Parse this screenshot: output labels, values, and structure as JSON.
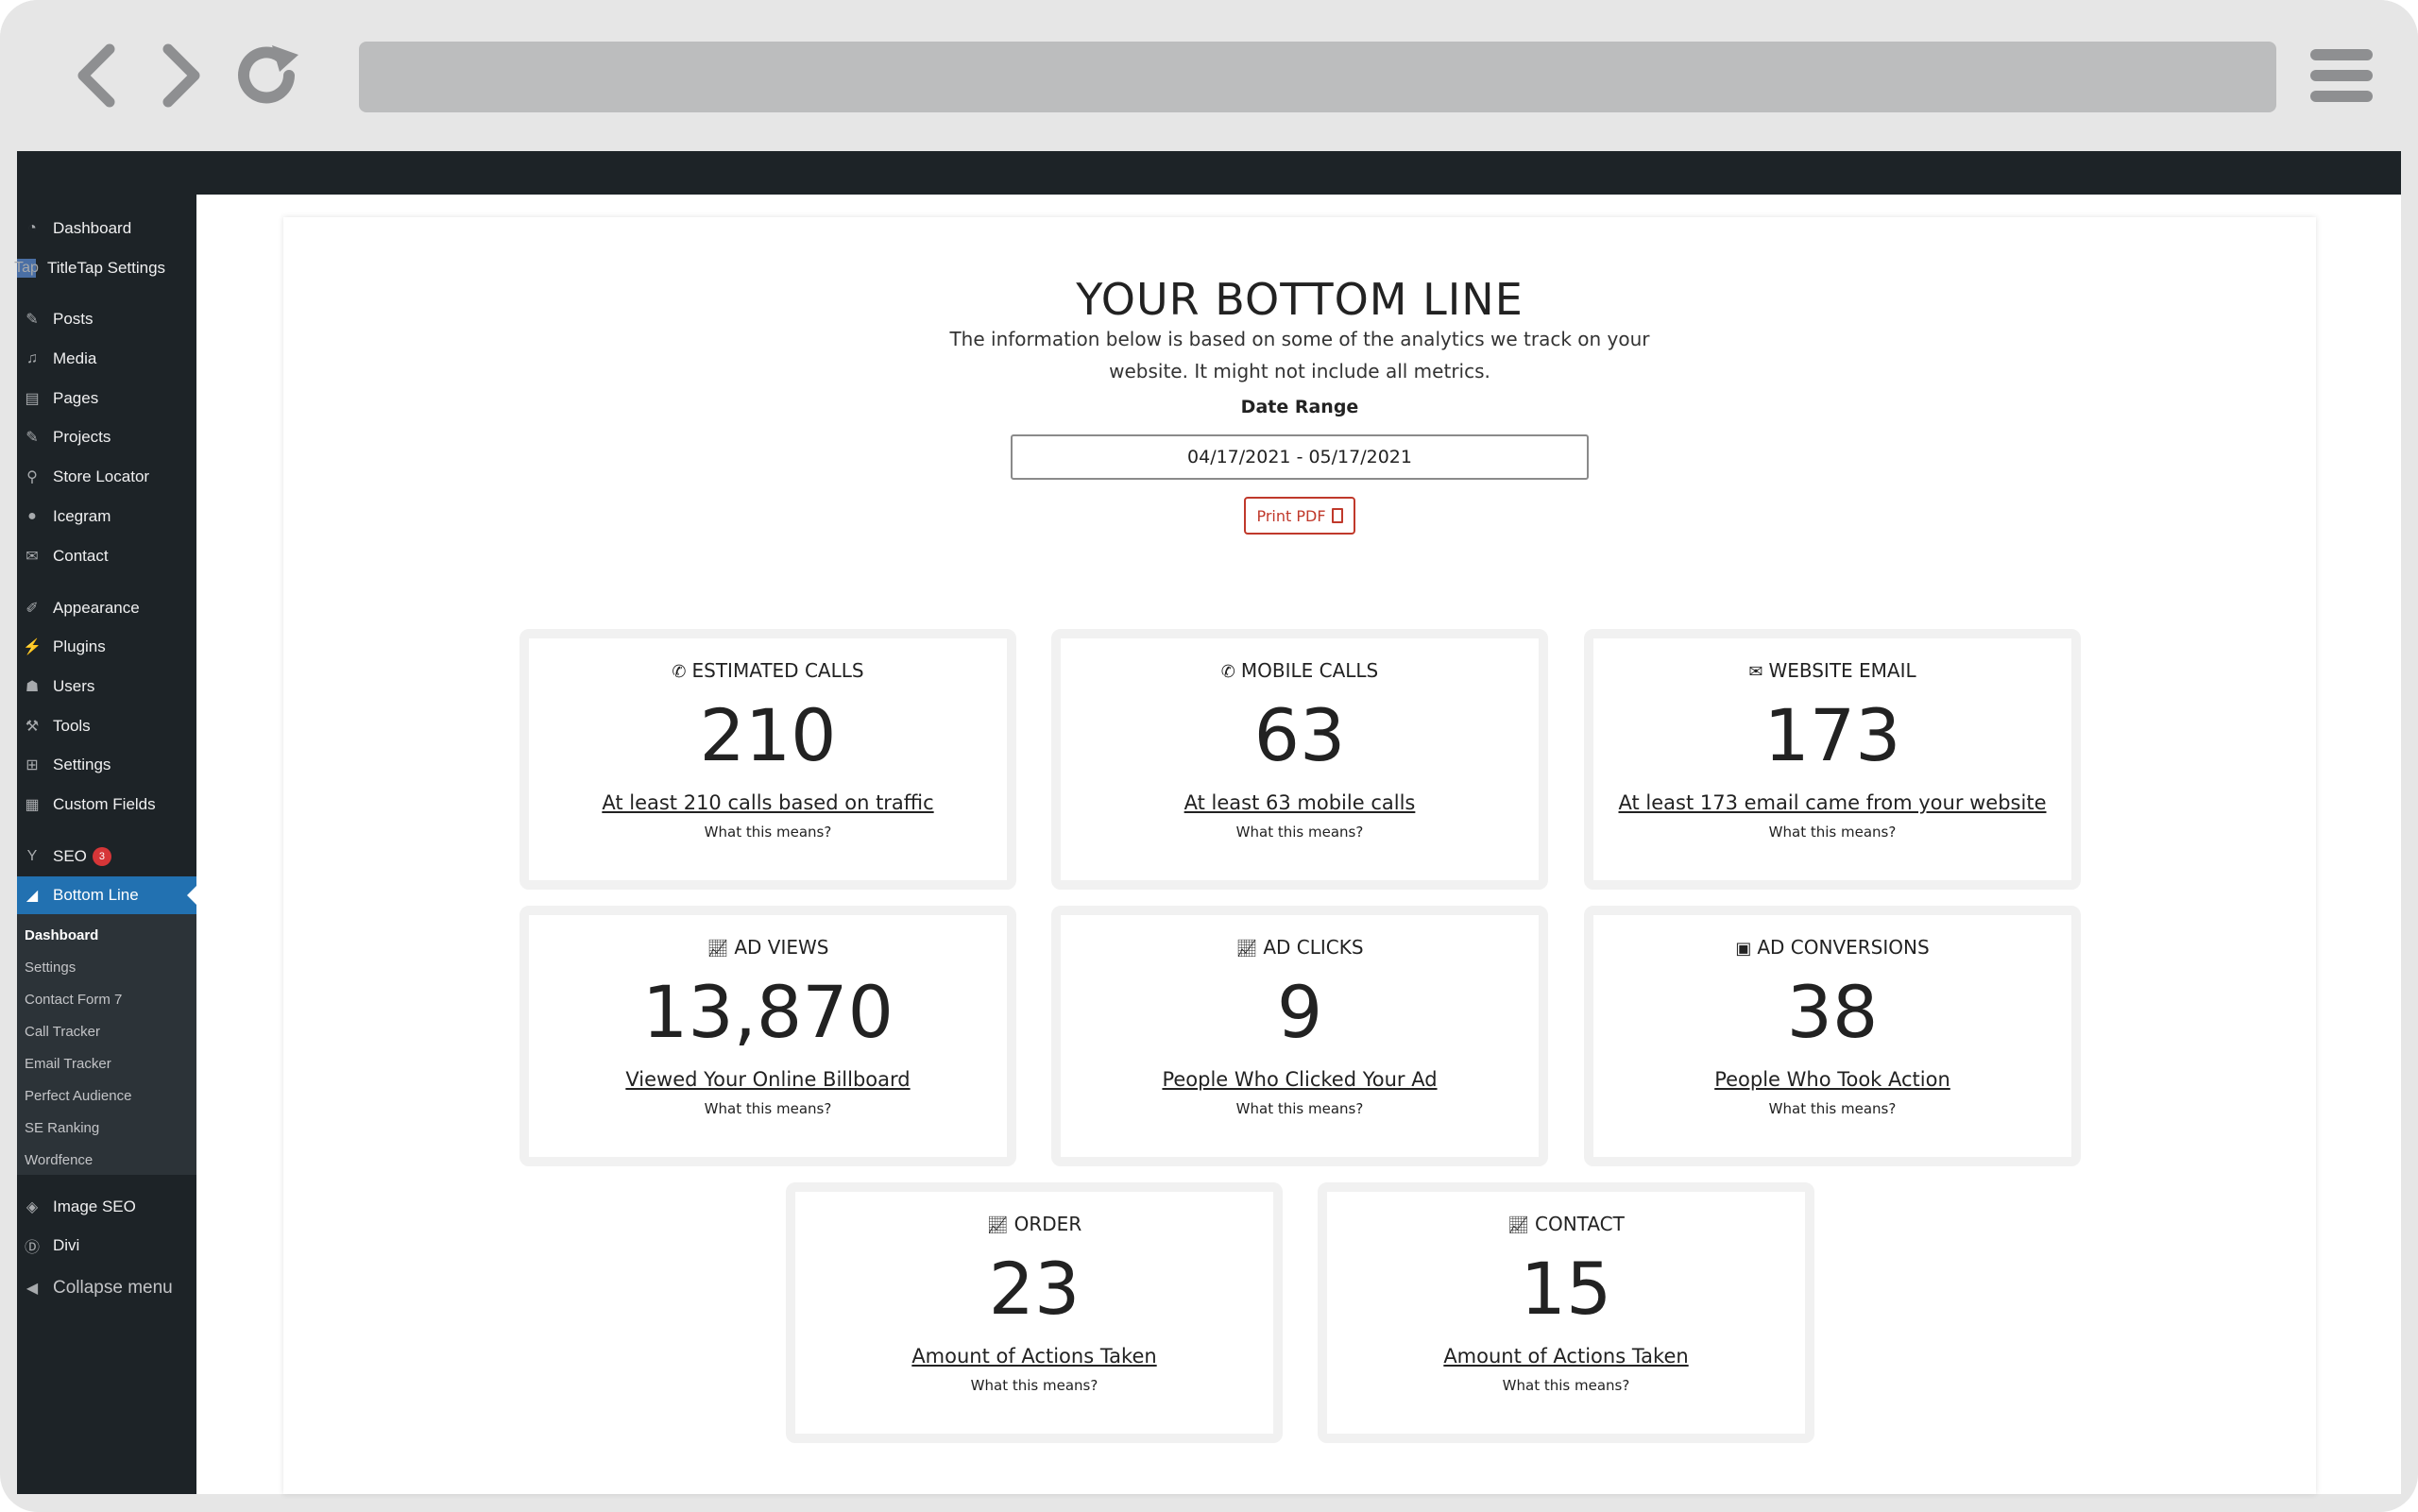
{
  "sidebar": {
    "items": [
      {
        "label": "Dashboard",
        "icon": "dashboard-icon"
      },
      {
        "label": "TitleTap Settings",
        "icon": "titletap-icon"
      },
      {
        "label": "Posts",
        "icon": "pin-icon"
      },
      {
        "label": "Media",
        "icon": "media-icon"
      },
      {
        "label": "Pages",
        "icon": "pages-icon"
      },
      {
        "label": "Projects",
        "icon": "pin-icon"
      },
      {
        "label": "Store Locator",
        "icon": "location-pin-icon"
      },
      {
        "label": "Icegram",
        "icon": "icegram-icon"
      },
      {
        "label": "Contact",
        "icon": "mail-icon"
      },
      {
        "label": "Appearance",
        "icon": "paintbrush-icon"
      },
      {
        "label": "Plugins",
        "icon": "plugins-icon"
      },
      {
        "label": "Users",
        "icon": "user-icon"
      },
      {
        "label": "Tools",
        "icon": "wrench-icon"
      },
      {
        "label": "Settings",
        "icon": "settings-icon"
      },
      {
        "label": "Custom Fields",
        "icon": "table-icon"
      },
      {
        "label": "SEO",
        "icon": "yoast-icon",
        "badge": "3"
      },
      {
        "label": "Bottom Line",
        "icon": "chart-icon"
      },
      {
        "label": "Image SEO",
        "icon": "image-seo-icon"
      },
      {
        "label": "Divi",
        "icon": "divi-icon"
      },
      {
        "label": "Collapse menu",
        "icon": "collapse-icon"
      }
    ],
    "tap_text": "Tap",
    "submenu": [
      "Dashboard",
      "Settings",
      "Contact Form 7",
      "Call Tracker",
      "Email Tracker",
      "Perfect Audience",
      "SE Ranking",
      "Wordfence"
    ]
  },
  "main": {
    "title": "YOUR BOTTOM LINE",
    "subtitle": "The information below is based on some of the analytics we track on your website. It might not include all metrics.",
    "date_label": "Date Range",
    "date_value": "04/17/2021 - 05/17/2021",
    "print_label": "Print PDF",
    "cards": [
      {
        "title": "ESTIMATED CALLS",
        "icon": "phone-icon",
        "value": "210",
        "link": "At least 210 calls based on traffic",
        "what": "What this means?"
      },
      {
        "title": "MOBILE CALLS",
        "icon": "phone-icon",
        "value": "63",
        "link": "At least 63 mobile calls",
        "what": "What this means?"
      },
      {
        "title": "WEBSITE EMAIL",
        "icon": "envelope-icon",
        "value": "173",
        "link": "At least 173 email came from your website",
        "what": "What this means?"
      },
      {
        "title": "AD VIEWS",
        "icon": "line-chart-icon",
        "value": "13,870",
        "link": "Viewed Your Online Billboard",
        "what": "What this means?"
      },
      {
        "title": "AD CLICKS",
        "icon": "line-chart-icon",
        "value": "9",
        "link": "People Who Clicked Your Ad",
        "what": "What this means?"
      },
      {
        "title": "AD CONVERSIONS",
        "icon": "money-icon",
        "value": "38",
        "link": "People Who Took Action",
        "what": "What this means?"
      },
      {
        "title": "ORDER",
        "icon": "line-chart-icon",
        "value": "23",
        "link": "Amount of Actions Taken",
        "what": "What this means?"
      },
      {
        "title": "CONTACT",
        "icon": "line-chart-icon",
        "value": "15",
        "link": "Amount of Actions Taken",
        "what": "What this means?"
      }
    ]
  }
}
